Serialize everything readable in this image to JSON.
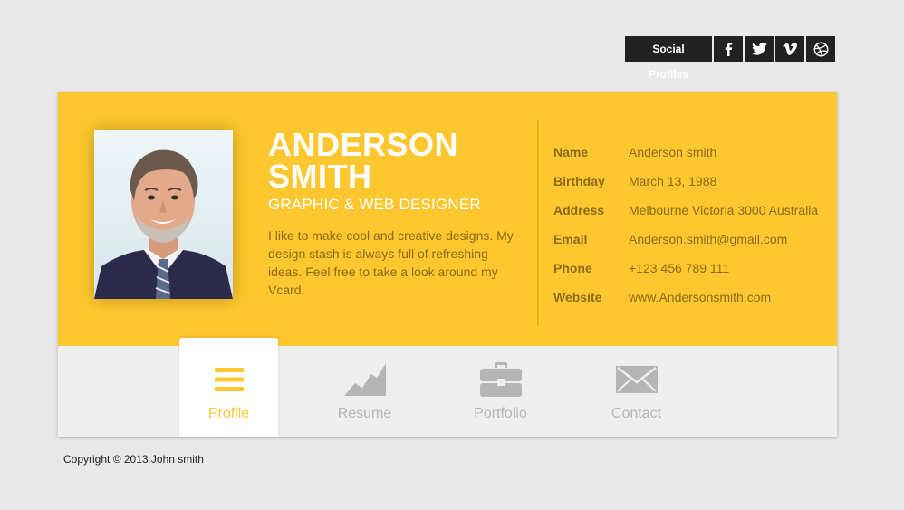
{
  "social": {
    "label": "Social Profiles",
    "icons": [
      "facebook-icon",
      "twitter-icon",
      "vimeo-icon",
      "dribbble-icon"
    ]
  },
  "profile": {
    "first_name": "ANDERSON",
    "last_name": "SMITH",
    "role": "GRAPHIC & WEB DESIGNER",
    "bio": "I like to make cool and creative designs. My design stash is always full of refreshing ideas. Feel free to take a look around my Vcard."
  },
  "info": [
    {
      "key": "Name",
      "value": "Anderson smith"
    },
    {
      "key": "Birthday",
      "value": "March 13, 1988"
    },
    {
      "key": "Address",
      "value": "Melbourne Victoria 3000 Australia"
    },
    {
      "key": "Email",
      "value": "Anderson.smith@gmail.com"
    },
    {
      "key": "Phone",
      "value": "+123 456 789 111"
    },
    {
      "key": "Website",
      "value": "www.Andersonsmith.com"
    }
  ],
  "tabs": [
    {
      "label": "Profile",
      "icon": "menu-icon",
      "active": true
    },
    {
      "label": "Resume",
      "icon": "chart-icon",
      "active": false
    },
    {
      "label": "Portfolio",
      "icon": "briefcase-icon",
      "active": false
    },
    {
      "label": "Contact",
      "icon": "envelope-icon",
      "active": false
    }
  ],
  "footer": {
    "copyright": "Copyright © 2013 John smith"
  },
  "colors": {
    "accent": "#fdc82f",
    "text_dark": "#8b6b16",
    "tab_inactive": "#b5b5b5"
  }
}
